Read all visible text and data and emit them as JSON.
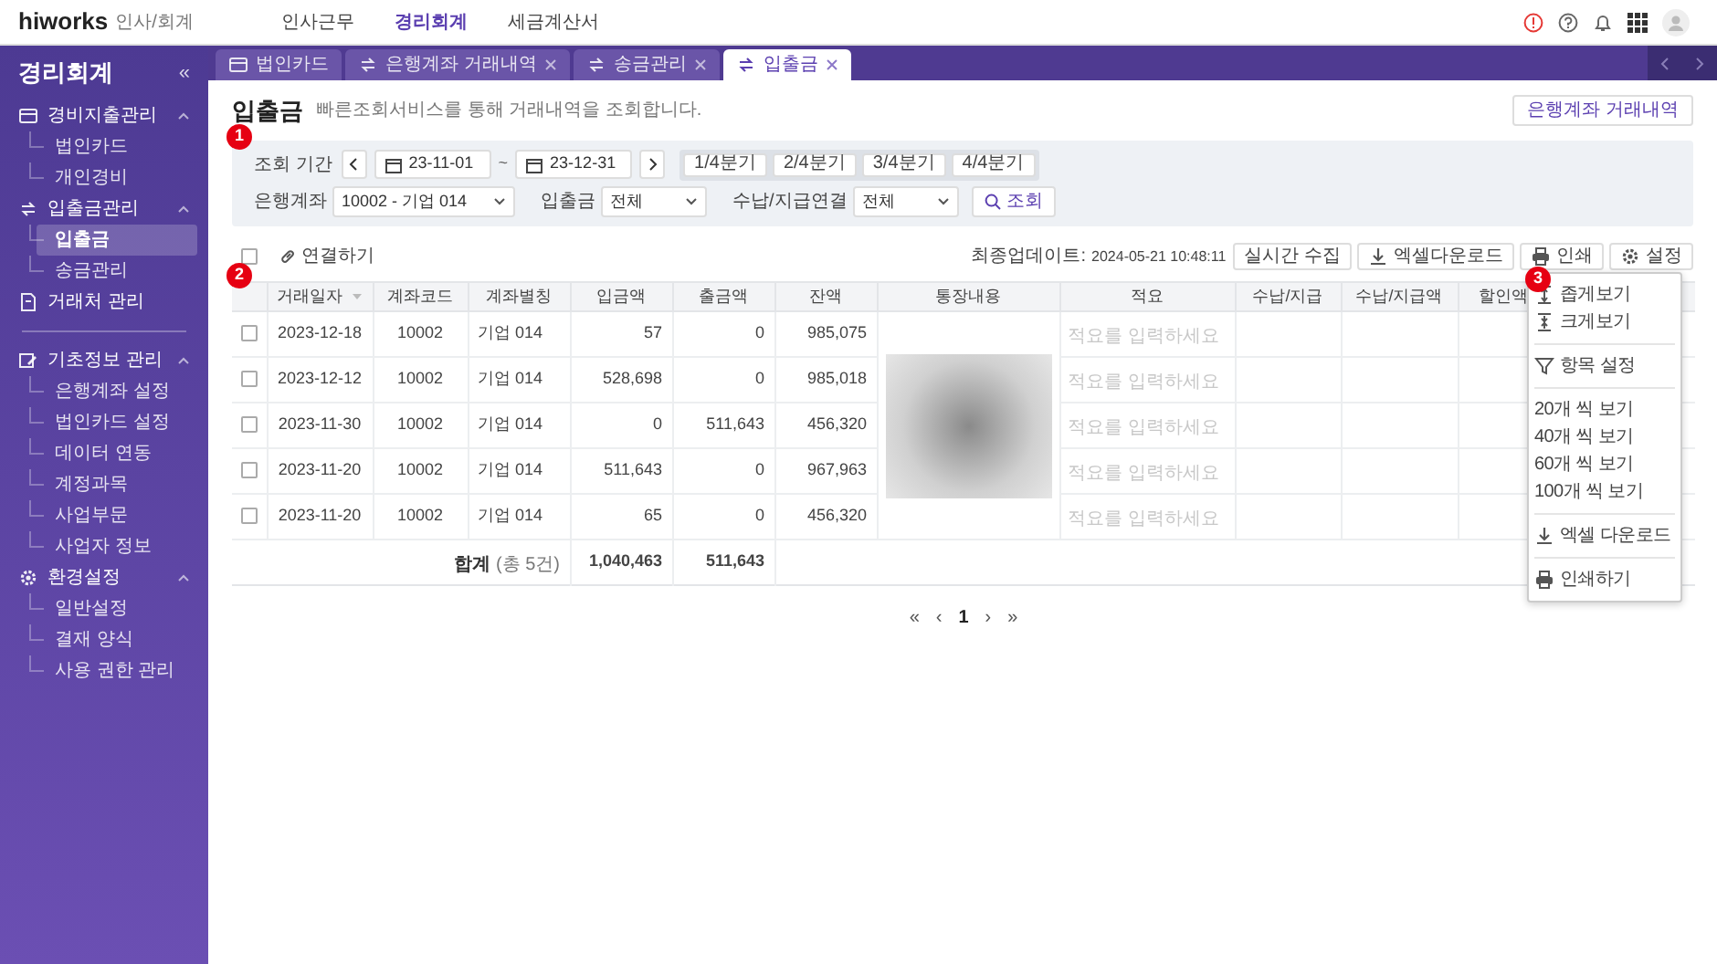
{
  "header": {
    "logo": "hiworks",
    "product": "인사/회계",
    "nav": [
      {
        "label": "인사근무",
        "selected": false
      },
      {
        "label": "경리회계",
        "selected": true
      },
      {
        "label": "세금계산서",
        "selected": false
      }
    ]
  },
  "sidebar": {
    "title": "경리회계",
    "collapse": "«",
    "sections": [
      {
        "label": "경비지출관리",
        "kind": "card",
        "expanded": true,
        "children": [
          {
            "label": "법인카드",
            "selected": false
          },
          {
            "label": "개인경비",
            "selected": false
          }
        ]
      },
      {
        "label": "입출금관리",
        "kind": "swap",
        "expanded": true,
        "children": [
          {
            "label": "입출금",
            "selected": true
          },
          {
            "label": "송금관리",
            "selected": false
          }
        ]
      },
      {
        "label": "거래처 관리",
        "kind": "doc"
      },
      {
        "label": "기초정보 관리",
        "kind": "edit",
        "expanded": true,
        "children": [
          {
            "label": "은행계좌 설정",
            "selected": false
          },
          {
            "label": "법인카드 설정",
            "selected": false
          },
          {
            "label": "데이터 연동",
            "selected": false
          },
          {
            "label": "계정과목",
            "selected": false
          },
          {
            "label": "사업부문",
            "selected": false
          },
          {
            "label": "사업자 정보",
            "selected": false
          }
        ]
      },
      {
        "label": "환경설정",
        "kind": "gear",
        "expanded": true,
        "children": [
          {
            "label": "일반설정",
            "selected": false
          },
          {
            "label": "결재 양식",
            "selected": false
          },
          {
            "label": "사용 권한 관리",
            "selected": false
          }
        ]
      }
    ]
  },
  "tabs": [
    {
      "label": "법인카드",
      "kind": "card",
      "closable": false,
      "selected": false
    },
    {
      "label": "은행계좌 거래내역",
      "kind": "swap",
      "closable": true,
      "selected": false
    },
    {
      "label": "송금관리",
      "kind": "swap",
      "closable": true,
      "selected": false
    },
    {
      "label": "입출금",
      "kind": "swap",
      "closable": true,
      "selected": true
    }
  ],
  "page": {
    "title": "입출금",
    "description": "빠른조회서비스를 통해 거래내역을 조회합니다.",
    "link_button": "은행계좌 거래내역"
  },
  "filter": {
    "marker": "1",
    "period_label": "조회 기간",
    "start": "23-11-01",
    "separator": "~",
    "end": "23-12-31",
    "quarters": [
      "1/4분기",
      "2/4분기",
      "3/4분기",
      "4/4분기"
    ],
    "selects": [
      {
        "label": "은행계좌",
        "value": "10002 - 기업 014"
      },
      {
        "label": "입출금",
        "value": "전체"
      },
      {
        "label": "수납/지급연결",
        "value": "전체"
      }
    ],
    "search": "조회"
  },
  "toolbar": {
    "marker": "2",
    "select_all": false,
    "connect": "연결하기",
    "updated_label": "최종업데이트:",
    "updated": "2024-05-21 10:48:11",
    "buttons": [
      {
        "label": "실시간 수집"
      },
      {
        "label": "엑셀다운로드",
        "kind": "download"
      },
      {
        "label": "인쇄",
        "kind": "print"
      },
      {
        "label": "설정",
        "kind": "gear"
      }
    ]
  },
  "table": {
    "columns": [
      "거래일자",
      "계좌코드",
      "계좌별칭",
      "입금액",
      "출금액",
      "잔액",
      "통장내용",
      "적요",
      "수납/지급",
      "수납/지급액",
      "할인액"
    ],
    "rows": [
      {
        "checked": false,
        "date": "2023-12-18",
        "code": "10002",
        "alias": "기업 014",
        "deposit": "57",
        "withdrawal": "0",
        "balance": "985,075",
        "memo_placeholder": "적요를 입력하세요"
      },
      {
        "checked": false,
        "date": "2023-12-12",
        "code": "10002",
        "alias": "기업 014",
        "deposit": "528,698",
        "withdrawal": "0",
        "balance": "985,018",
        "memo_placeholder": "적요를 입력하세요"
      },
      {
        "checked": false,
        "date": "2023-11-30",
        "code": "10002",
        "alias": "기업 014",
        "deposit": "0",
        "withdrawal": "511,643",
        "balance": "456,320",
        "memo_placeholder": "적요를 입력하세요"
      },
      {
        "checked": false,
        "date": "2023-11-20",
        "code": "10002",
        "alias": "기업 014",
        "deposit": "511,643",
        "withdrawal": "0",
        "balance": "967,963",
        "memo_placeholder": "적요를 입력하세요"
      },
      {
        "checked": false,
        "date": "2023-11-20",
        "code": "10002",
        "alias": "기업 014",
        "deposit": "65",
        "withdrawal": "0",
        "balance": "456,320",
        "memo_placeholder": "적요를 입력하세요"
      }
    ],
    "total_label": "합계",
    "total_count": "(총 5건)",
    "total_deposit": "1,040,463",
    "total_withdrawal": "511,643"
  },
  "pagination": {
    "first": "«",
    "prev": "‹",
    "pages": [
      {
        "label": "1",
        "selected": true
      }
    ],
    "next": "›",
    "last": "»"
  },
  "settings_menu": {
    "marker": "3",
    "groups": [
      [
        {
          "label": "좁게보기",
          "kind": "narrow"
        },
        {
          "label": "크게보기",
          "kind": "wide"
        }
      ],
      [
        {
          "label": "항목 설정",
          "kind": "filter"
        }
      ],
      [
        {
          "label": "20개 씩 보기"
        },
        {
          "label": "40개 씩 보기"
        },
        {
          "label": "60개 씩 보기"
        },
        {
          "label": "100개 씩 보기"
        }
      ],
      [
        {
          "label": "엑셀 다운로드",
          "kind": "download"
        }
      ],
      [
        {
          "label": "인쇄하기",
          "kind": "print"
        }
      ]
    ]
  }
}
